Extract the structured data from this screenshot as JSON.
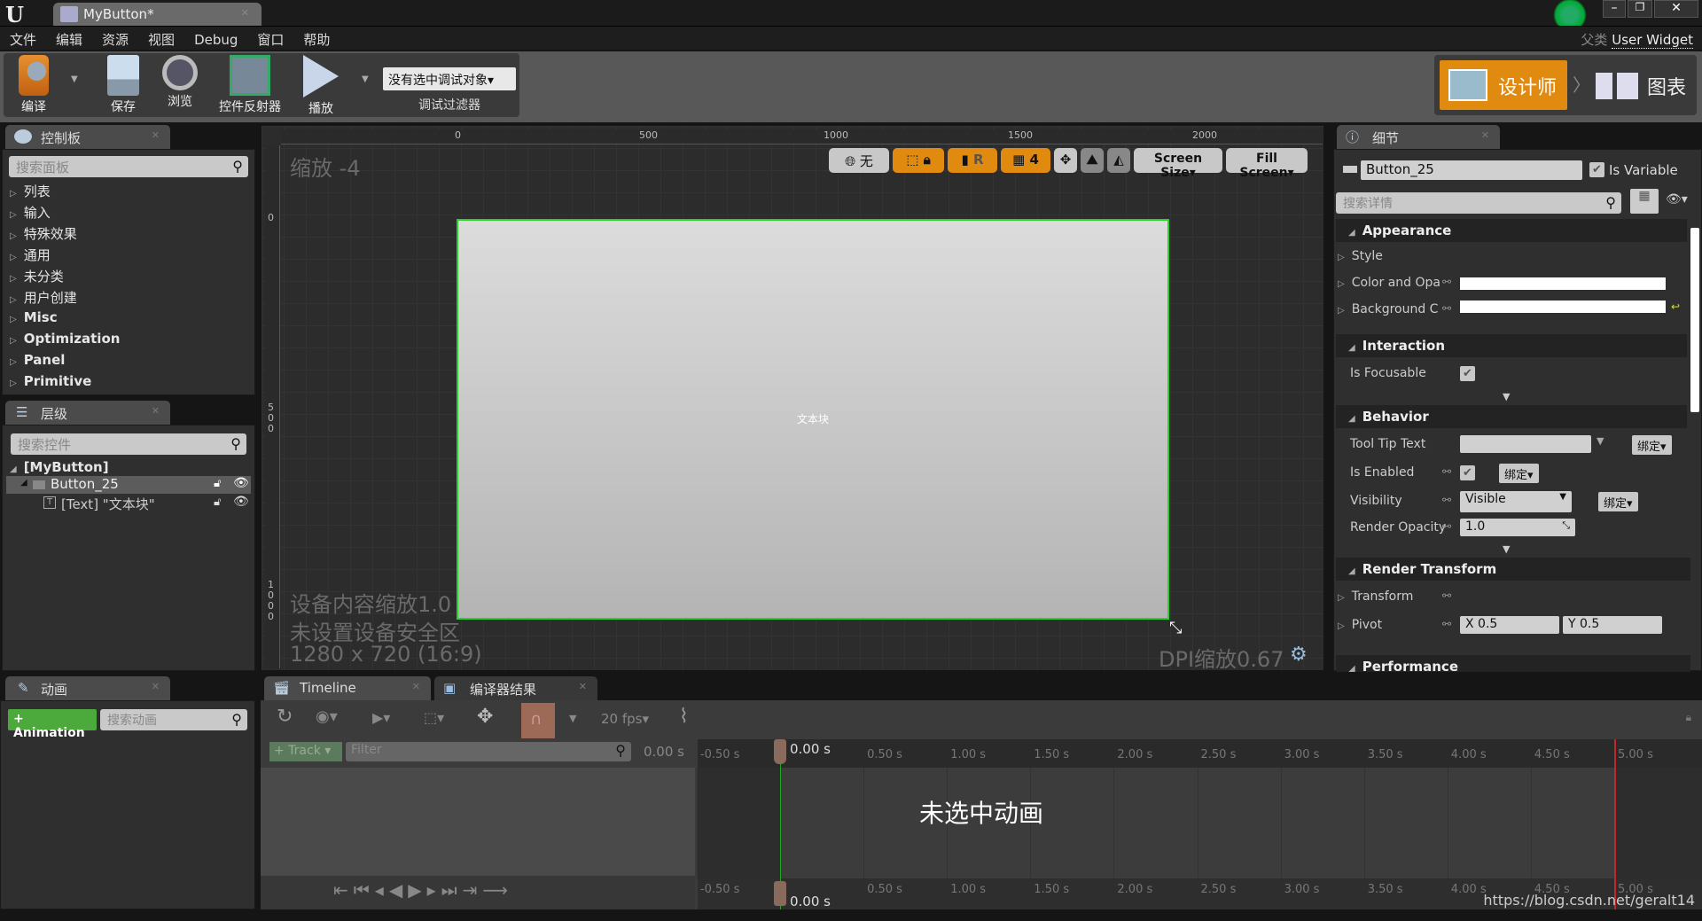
{
  "titlebar": {
    "doc_tab": "MyButton*",
    "parent_class_label": "父类",
    "parent_class": "User Widget"
  },
  "menu": [
    "文件",
    "编辑",
    "资源",
    "视图",
    "Debug",
    "窗口",
    "帮助"
  ],
  "toolbar": {
    "compile": "编译",
    "save": "保存",
    "browse": "浏览",
    "widget_reflector": "控件反射器",
    "play": "播放",
    "debug_target": "没有选中调试对象▾",
    "debug_filter": "调试过滤器",
    "designer": "设计师",
    "graph": "图表"
  },
  "palette": {
    "tab": "控制板",
    "search_placeholder": "搜索面板",
    "items": [
      "列表",
      "输入",
      "特殊效果",
      "通用",
      "未分类",
      "用户创建",
      "Misc",
      "Optimization",
      "Panel",
      "Primitive"
    ]
  },
  "hierarchy": {
    "tab": "层级",
    "search_placeholder": "搜索控件",
    "root": "[MyButton]",
    "child": "Button_25",
    "grandchild": "[Text] \"文本块\""
  },
  "viewport": {
    "zoom": "缩放 -4",
    "ruler_top": [
      "0",
      "500",
      "1000",
      "1500",
      "2000"
    ],
    "ruler_left": [
      "0",
      "500",
      "1000"
    ],
    "toolbar": {
      "world": "无",
      "grid_size": "4",
      "screen_size": "Screen Size▾",
      "fill_screen": "Fill Screen▾",
      "r": "R"
    },
    "canvas_text": "文本块",
    "device_scale": "设备内容缩放1.0",
    "safe_zone": "未设置设备安全区",
    "resolution": "1280 x 720 (16:9)",
    "dpi": "DPI缩放0.67"
  },
  "details": {
    "tab": "细节",
    "name": "Button_25",
    "is_variable": "Is Variable",
    "search_placeholder": "搜索详情",
    "sections": {
      "appearance": "Appearance",
      "interaction": "Interaction",
      "behavior": "Behavior",
      "render_transform": "Render Transform",
      "performance": "Performance"
    },
    "props": {
      "style": "Style",
      "color": "Color and Opa",
      "background": "Background C",
      "is_focusable": "Is Focusable",
      "tooltip": "Tool Tip Text",
      "is_enabled": "Is Enabled",
      "visibility": "Visibility",
      "visibility_value": "Visible",
      "render_opacity": "Render Opacity",
      "render_opacity_value": "1.0",
      "transform": "Transform",
      "pivot": "Pivot",
      "pivot_x": "X  0.5",
      "pivot_y": "Y  0.5",
      "bind": "绑定▾"
    },
    "checked": {
      "is_variable": true,
      "is_focusable": true,
      "is_enabled": true
    }
  },
  "animations": {
    "tab": "动画",
    "add": "+ Animation",
    "search_placeholder": "搜索动画"
  },
  "timeline": {
    "tab": "Timeline",
    "compiler_tab": "编译器结果",
    "fps": "20 fps▾",
    "add_track": "+ Track ▾",
    "filter_placeholder": "Filter",
    "time": "0.00 s",
    "playhead_label": "0.00 s",
    "no_anim": "未选中动画",
    "ticks": [
      "-0.50 s",
      "0.50 s",
      "1.00 s",
      "1.50 s",
      "2.00 s",
      "2.50 s",
      "3.00 s",
      "3.50 s",
      "4.00 s",
      "4.50 s",
      "5.00 s"
    ]
  },
  "watermark": "https://blog.csdn.net/geralt14",
  "colors": {
    "accent": "#e08a10",
    "selection": "#2bd12b",
    "end_marker": "#c0282d"
  }
}
